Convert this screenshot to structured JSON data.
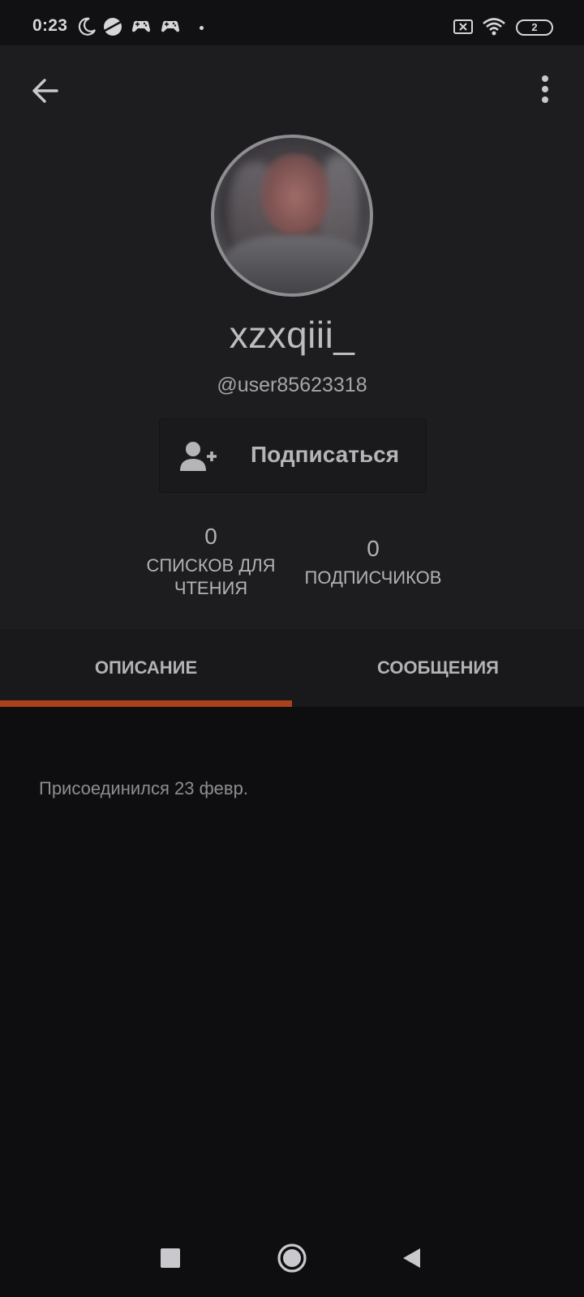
{
  "status_bar": {
    "time": "0:23",
    "battery": "2",
    "icons": [
      "moon-icon",
      "planet-icon",
      "gamepad-icon",
      "gamepad-icon",
      "notification-dot",
      "sim-off-icon",
      "wifi-icon",
      "battery-icon"
    ]
  },
  "header": {
    "back_icon": "arrow-left-icon",
    "more_icon": "more-vertical-icon"
  },
  "profile": {
    "display_name": "xzxqiii_",
    "username": "@user85623318",
    "follow_button": {
      "label": "Подписаться",
      "icon": "user-plus-icon"
    },
    "stats": {
      "reading_lists": {
        "count": "0",
        "label": "списков для чтения"
      },
      "followers": {
        "count": "0",
        "label": "подписчиков"
      }
    }
  },
  "tabs": [
    {
      "label": "ОПИСАНИЕ",
      "active": true
    },
    {
      "label": "СООБЩЕНИЯ",
      "active": false
    }
  ],
  "description": {
    "joined": "Присоединился 23 февр."
  },
  "nav_bar": {
    "icons": [
      "recents-square-icon",
      "home-circle-icon",
      "back-triangle-icon"
    ]
  },
  "colors": {
    "accent": "#a8421d",
    "header_bg": "#1d1c1f",
    "page_bg": "#0e0d10"
  }
}
